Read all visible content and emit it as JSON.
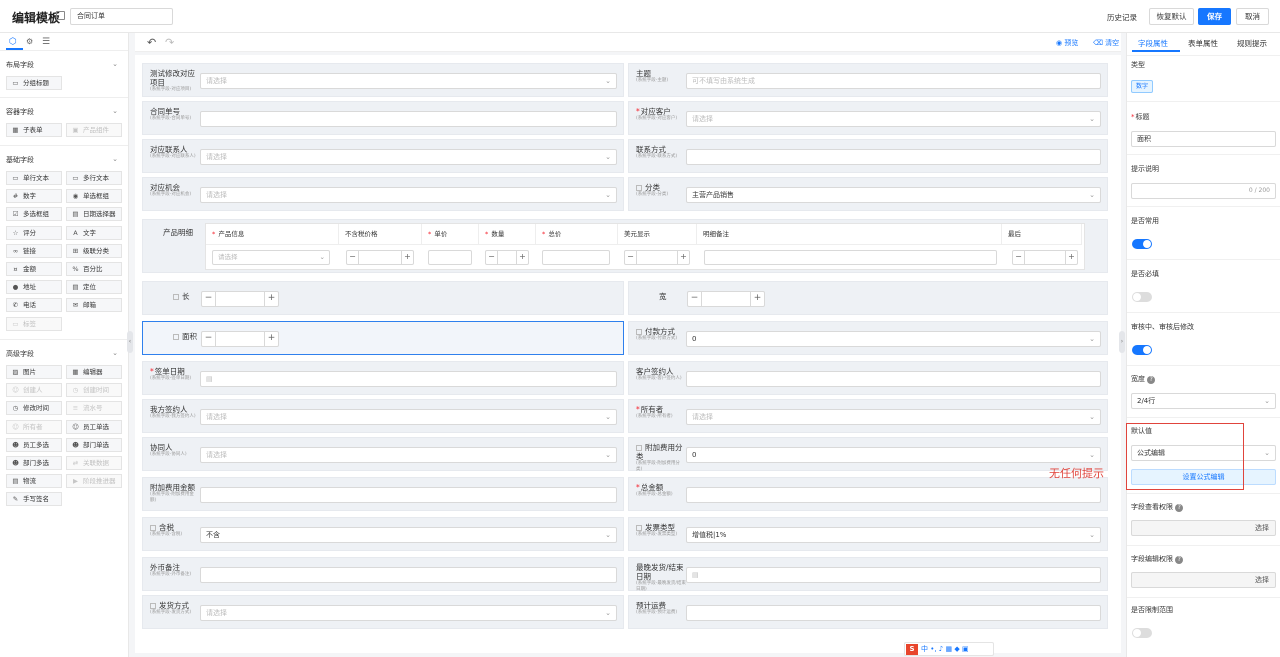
{
  "header": {
    "title": "编辑模板",
    "template_name": "合同订单",
    "history": "历史记录",
    "restore_default": "恢复默认",
    "save": "保存",
    "cancel": "取消"
  },
  "left_panel": {
    "groups": [
      {
        "title": "布局字段",
        "items": [
          {
            "label": "分组标题",
            "icon": "layout-icon",
            "disabled": false
          }
        ]
      },
      {
        "title": "容器字段",
        "items": [
          {
            "label": "子表单",
            "icon": "table-icon",
            "disabled": false
          },
          {
            "label": "产品组件",
            "icon": "box-icon",
            "disabled": true
          }
        ]
      },
      {
        "title": "基础字段",
        "items": [
          {
            "label": "单行文本",
            "icon": "input-icon",
            "disabled": false
          },
          {
            "label": "多行文本",
            "icon": "textarea-icon",
            "disabled": false
          },
          {
            "label": "数字",
            "icon": "number-icon",
            "disabled": false
          },
          {
            "label": "单选框组",
            "icon": "radio-icon",
            "disabled": false
          },
          {
            "label": "多选框组",
            "icon": "checkbox-icon",
            "disabled": false
          },
          {
            "label": "日期选择器",
            "icon": "calendar-icon",
            "disabled": false
          },
          {
            "label": "评分",
            "icon": "star-icon",
            "disabled": false
          },
          {
            "label": "文字",
            "icon": "text-icon",
            "disabled": false
          },
          {
            "label": "链接",
            "icon": "link-icon",
            "disabled": false
          },
          {
            "label": "级联分类",
            "icon": "cascade-icon",
            "disabled": false
          },
          {
            "label": "金额",
            "icon": "money-icon",
            "disabled": false
          },
          {
            "label": "百分比",
            "icon": "percent-icon",
            "disabled": false
          },
          {
            "label": "地址",
            "icon": "location-icon",
            "disabled": false
          },
          {
            "label": "定位",
            "icon": "locate-icon",
            "disabled": false
          },
          {
            "label": "电话",
            "icon": "phone-icon",
            "disabled": false
          },
          {
            "label": "邮箱",
            "icon": "mail-icon",
            "disabled": false
          },
          {
            "label": "标签",
            "icon": "tag-icon",
            "disabled": true
          }
        ]
      },
      {
        "title": "高级字段",
        "items": [
          {
            "label": "图片",
            "icon": "image-icon",
            "disabled": false
          },
          {
            "label": "编辑器",
            "icon": "editor-icon",
            "disabled": false
          },
          {
            "label": "创建人",
            "icon": "user-icon",
            "disabled": true
          },
          {
            "label": "创建时间",
            "icon": "clock-icon",
            "disabled": true
          },
          {
            "label": "修改时间",
            "icon": "clock-icon",
            "disabled": false
          },
          {
            "label": "流水号",
            "icon": "serial-icon",
            "disabled": true
          },
          {
            "label": "所有者",
            "icon": "owner-icon",
            "disabled": true
          },
          {
            "label": "员工单选",
            "icon": "user-icon",
            "disabled": false
          },
          {
            "label": "员工多选",
            "icon": "users-icon",
            "disabled": false
          },
          {
            "label": "部门单选",
            "icon": "dept-icon",
            "disabled": false
          },
          {
            "label": "部门多选",
            "icon": "dept-icon",
            "disabled": false
          },
          {
            "label": "关联数据",
            "icon": "relation-icon",
            "disabled": true
          },
          {
            "label": "物流",
            "icon": "truck-icon",
            "disabled": false
          },
          {
            "label": "阶段推进器",
            "icon": "stage-icon",
            "disabled": true
          },
          {
            "label": "手写签名",
            "icon": "sign-icon",
            "disabled": false
          }
        ]
      }
    ]
  },
  "canvas": {
    "preview": "预览",
    "clear": "清空",
    "placeholder_select": "请选择",
    "fields": [
      {
        "label": "测试修改对应项目",
        "sub": "(系统字段-对应项目)",
        "req": false,
        "value": "请选择",
        "type": "select"
      },
      {
        "label": "主题",
        "sub": "(系统字段-主题)",
        "req": false,
        "value": "可不填写由系统生成",
        "type": "text"
      },
      {
        "label": "合同单号",
        "sub": "(系统字段-合同单号)",
        "req": false,
        "value": "",
        "type": "text"
      },
      {
        "label": "对应客户",
        "sub": "(系统字段-对应客户)",
        "req": true,
        "value": "请选择",
        "type": "select"
      },
      {
        "label": "对应联系人",
        "sub": "(系统字段-对应联系人)",
        "req": false,
        "value": "请选择",
        "type": "select"
      },
      {
        "label": "联系方式",
        "sub": "(系统字段-联系方式)",
        "req": false,
        "value": "",
        "type": "text"
      },
      {
        "label": "对应机会",
        "sub": "(系统字段-对应机会)",
        "req": false,
        "value": "请选择",
        "type": "select"
      },
      {
        "label": "分类",
        "sub": "(系统字段-分类)",
        "req": false,
        "value": "主营产品销售",
        "type": "select"
      },
      {
        "label": "长",
        "sub": "",
        "req": false,
        "value": "",
        "type": "number"
      },
      {
        "label": "宽",
        "sub": "",
        "req": false,
        "value": "",
        "type": "number"
      },
      {
        "label": "面积",
        "sub": "",
        "req": false,
        "value": "",
        "type": "number"
      },
      {
        "label": "付款方式",
        "sub": "(系统字段-付款方式)",
        "req": false,
        "value": "0",
        "type": "select"
      },
      {
        "label": "签单日期",
        "sub": "(系统字段-签单日期)",
        "req": true,
        "value": "",
        "type": "date"
      },
      {
        "label": "客户签约人",
        "sub": "(系统字段-客户签约人)",
        "req": false,
        "value": "",
        "type": "text"
      },
      {
        "label": "我方签约人",
        "sub": "(系统字段-我方签约人)",
        "req": false,
        "value": "请选择",
        "type": "select"
      },
      {
        "label": "所有者",
        "sub": "(系统字段-所有者)",
        "req": true,
        "value": "请选择",
        "type": "select"
      },
      {
        "label": "协同人",
        "sub": "(系统字段-协同人)",
        "req": false,
        "value": "请选择",
        "type": "select"
      },
      {
        "label": "附加费用分类",
        "sub": "(系统字段-附加费用分类)",
        "req": false,
        "value": "0",
        "type": "select"
      },
      {
        "label": "附加费用金额",
        "sub": "(系统字段-附加费用金额)",
        "req": false,
        "value": "",
        "type": "text"
      },
      {
        "label": "总金额",
        "sub": "(系统字段-总金额)",
        "req": true,
        "value": "",
        "type": "text"
      },
      {
        "label": "含税",
        "sub": "(系统字段-含税)",
        "req": false,
        "value": "不含",
        "type": "select"
      },
      {
        "label": "发票类型",
        "sub": "(系统字段-发票类型)",
        "req": false,
        "value": "增值税|1%",
        "type": "select"
      },
      {
        "label": "外币备注",
        "sub": "(系统字段-外币备注)",
        "req": false,
        "value": "",
        "type": "text"
      },
      {
        "label": "最晚发货/结束日期",
        "sub": "(系统字段-最晚发货/结束日期)",
        "req": false,
        "value": "",
        "type": "date"
      },
      {
        "label": "发货方式",
        "sub": "(系统字段-发货方式)",
        "req": false,
        "value": "请选择",
        "type": "select"
      },
      {
        "label": "预计运费",
        "sub": "(系统字段-预计运费)",
        "req": false,
        "value": "",
        "type": "text"
      }
    ],
    "product_table": {
      "label": "产品明细",
      "columns": [
        {
          "label": "产品信息",
          "req": true
        },
        {
          "label": "不含税价格",
          "req": false
        },
        {
          "label": "单价",
          "req": true
        },
        {
          "label": "数量",
          "req": true
        },
        {
          "label": "总价",
          "req": true
        },
        {
          "label": "美元显示",
          "req": false
        },
        {
          "label": "明细备注",
          "req": false
        },
        {
          "label": "最后",
          "req": false
        }
      ],
      "select_placeholder": "请选择"
    }
  },
  "right_panel": {
    "tabs": [
      "字段属性",
      "表单属性",
      "规则提示"
    ],
    "type_label": "类型",
    "type_value": "数字",
    "title_label": "标题",
    "title_value": "面积",
    "hint_label": "提示说明",
    "hint_counter": "0 / 200",
    "common_label": "是否常用",
    "common_on": true,
    "required_label": "是否必填",
    "required_on": false,
    "audit_label": "审核中、审核后修改",
    "audit_on": true,
    "width_label": "宽度",
    "width_value": "2/4行",
    "default_label": "默认值",
    "default_value": "公式编辑",
    "formula_btn": "设置公式编辑",
    "view_perm_label": "字段查看权限",
    "edit_perm_label": "字段编辑权限",
    "select_text": "选择",
    "limit_label": "是否限制范围",
    "limit_on": false
  },
  "annotation": "无任何提示",
  "ime": {
    "items": "中 •, ♪ ▦ ◆ ▣"
  },
  "colors": {
    "primary": "#1677ff",
    "annotation": "#e0443c",
    "required": "#f5222d"
  }
}
